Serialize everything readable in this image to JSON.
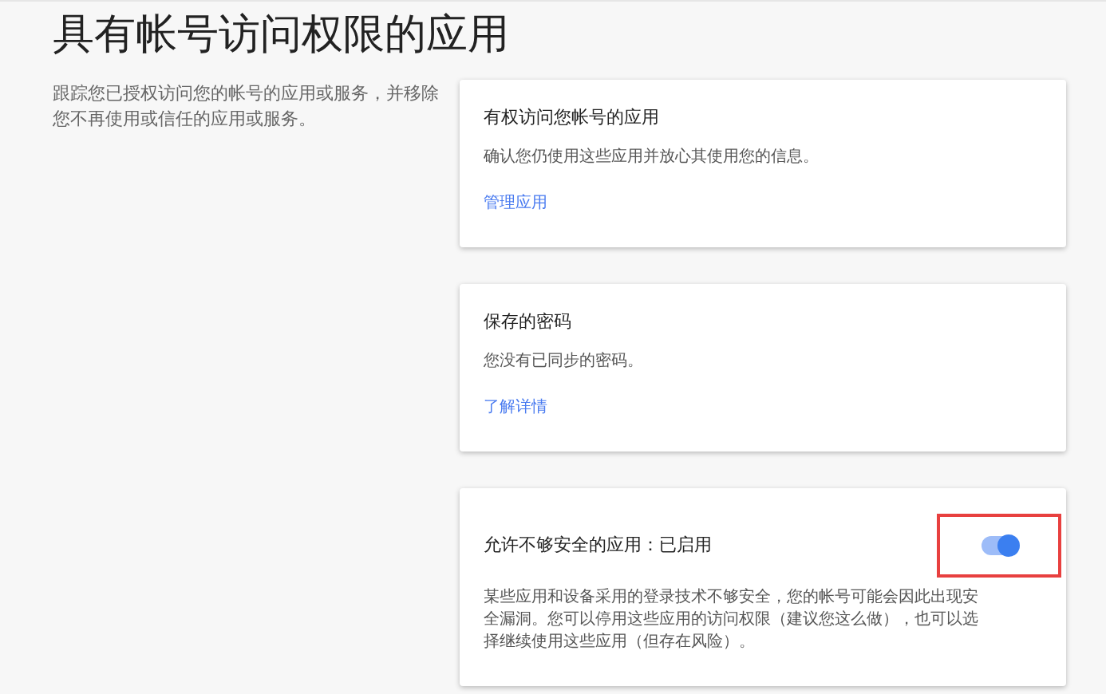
{
  "title": "具有帐号访问权限的应用",
  "intro": "跟踪您已授权访问您的帐号的应用或服务，并移除您不再使用或信任的应用或服务。",
  "cards": [
    {
      "kind": "link",
      "title": "有权访问您帐号的应用",
      "text": "确认您仍使用这些应用并放心其使用您的信息。",
      "link": "管理应用"
    },
    {
      "kind": "link",
      "title": "保存的密码",
      "text": "您没有已同步的密码。",
      "link": "了解详情"
    },
    {
      "kind": "toggle",
      "title": "允许不够安全的应用：已启用",
      "text": "某些应用和设备采用的登录技术不够安全，您的帐号可能会因此出现安全漏洞。您可以停用这些应用的访问权限（建议您这么做），也可以选择继续使用这些应用（但存在风险）。",
      "on": true,
      "highlighted": true
    }
  ]
}
